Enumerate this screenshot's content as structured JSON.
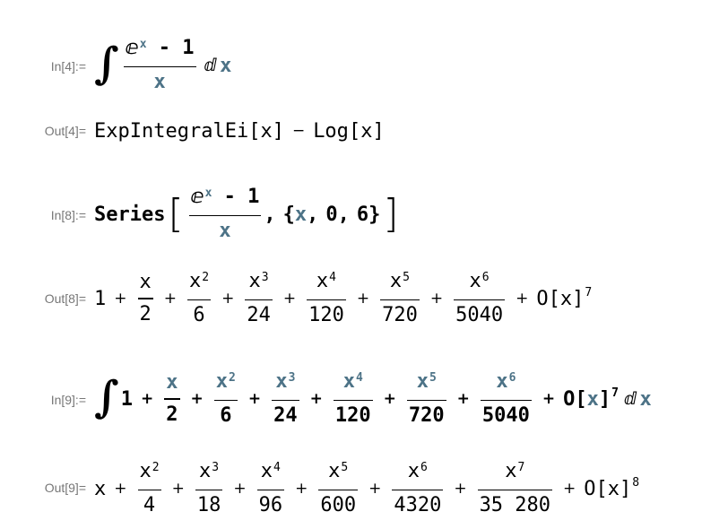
{
  "cells": [
    {
      "label": "In[4]:=",
      "integrand": {
        "e": "ⅇ",
        "exp": "x",
        "minus": "-",
        "one": "1",
        "den": "x"
      },
      "dd": "ⅆ",
      "var": "x"
    },
    {
      "label": "Out[4]=",
      "head1": "ExpIntegralEi",
      "arg1": "x",
      "minus": "−",
      "head2": "Log",
      "arg2": "x",
      "lb": "[",
      "rb": "]"
    },
    {
      "label": "In[8]:=",
      "func": "Series",
      "e": "ⅇ",
      "exp": "x",
      "minus": "-",
      "one": "1",
      "den": "x",
      "comma": ",",
      "list_open": "{",
      "var": "x",
      "zero": "0",
      "order": "6",
      "list_close": "}",
      "lb": "[",
      "rb": "]"
    },
    {
      "label": "Out[8]=",
      "lead": "1",
      "terms": [
        {
          "num": "x",
          "pow": "",
          "den": "2"
        },
        {
          "num": "x",
          "pow": "2",
          "den": "6"
        },
        {
          "num": "x",
          "pow": "3",
          "den": "24"
        },
        {
          "num": "x",
          "pow": "4",
          "den": "120"
        },
        {
          "num": "x",
          "pow": "5",
          "den": "720"
        },
        {
          "num": "x",
          "pow": "6",
          "den": "5040"
        }
      ],
      "plus": "+",
      "O": "O",
      "Oarg": "x",
      "Opow": "7",
      "lb": "[",
      "rb": "]"
    },
    {
      "label": "In[9]:=",
      "lead": "1",
      "terms": [
        {
          "num": "x",
          "pow": "",
          "den": "2"
        },
        {
          "num": "x",
          "pow": "2",
          "den": "6"
        },
        {
          "num": "x",
          "pow": "3",
          "den": "24"
        },
        {
          "num": "x",
          "pow": "4",
          "den": "120"
        },
        {
          "num": "x",
          "pow": "5",
          "den": "720"
        },
        {
          "num": "x",
          "pow": "6",
          "den": "5040"
        }
      ],
      "plus": "+",
      "O": "O",
      "Oarg": "x",
      "Opow": "7",
      "dd": "ⅆ",
      "var": "x",
      "lb": "[",
      "rb": "]"
    },
    {
      "label": "Out[9]=",
      "lead": "x",
      "terms": [
        {
          "num": "x",
          "pow": "2",
          "den": "4"
        },
        {
          "num": "x",
          "pow": "3",
          "den": "18"
        },
        {
          "num": "x",
          "pow": "4",
          "den": "96"
        },
        {
          "num": "x",
          "pow": "5",
          "den": "600"
        },
        {
          "num": "x",
          "pow": "6",
          "den": "4320"
        },
        {
          "num": "x",
          "pow": "7",
          "den": "35 280"
        }
      ],
      "plus": "+",
      "O": "O",
      "Oarg": "x",
      "Opow": "8",
      "lb": "[",
      "rb": "]"
    }
  ],
  "colors": {
    "variable": "#4d7387",
    "label": "#777777",
    "text": "#000000"
  },
  "icons": {
    "integral": "∫"
  }
}
